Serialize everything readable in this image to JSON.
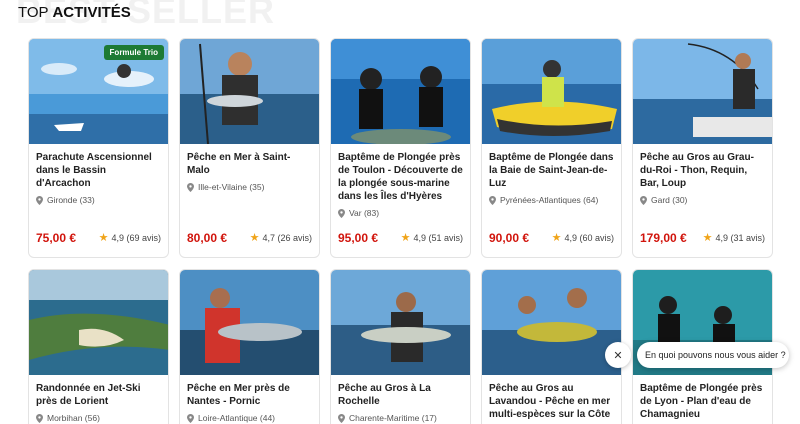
{
  "background_word": "BEST SELLER",
  "section": {
    "title_prefix": "TOP ",
    "title_bold": "ACTIVITÉS"
  },
  "cards": [
    {
      "title": "Parachute Ascensionnel dans le Bassin d'Arcachon",
      "location": "Gironde (33)",
      "price": "75,00 €",
      "rating": "4,9 (69 avis)",
      "badge": "Formule Trio"
    },
    {
      "title": "Pêche en Mer à Saint-Malo",
      "location": "Ille-et-Vilaine (35)",
      "price": "80,00 €",
      "rating": "4,7 (26 avis)"
    },
    {
      "title": "Baptême de Plongée près de Toulon - Découverte de la plongée sous-marine dans les Îles d'Hyères",
      "location": "Var (83)",
      "price": "95,00 €",
      "rating": "4,9 (51 avis)"
    },
    {
      "title": "Baptême de Plongée dans la Baie de Saint-Jean-de-Luz",
      "location": "Pyrénées-Atlantiques (64)",
      "price": "90,00 €",
      "rating": "4,9 (60 avis)"
    },
    {
      "title": "Pêche au Gros au Grau-du-Roi - Thon, Requin, Bar, Loup",
      "location": "Gard (30)",
      "price": "179,00 €",
      "rating": "4,9 (31 avis)"
    },
    {
      "title": "Randonnée en Jet-Ski près de Lorient",
      "location": "Morbihan (56)"
    },
    {
      "title": "Pêche en Mer près de Nantes - Pornic",
      "location": "Loire-Atlantique (44)"
    },
    {
      "title": "Pêche au Gros à La Rochelle",
      "location": "Charente-Maritime (17)"
    },
    {
      "title": "Pêche au Gros au Lavandou - Pêche en mer multi-espèces sur la Côte",
      "location": ""
    },
    {
      "title": "Baptême de Plongée près de Lyon - Plan d'eau de Chamagnieu",
      "location": ""
    }
  ],
  "chat": {
    "close": "✕",
    "prompt": "En quoi pouvons nous vous aider ?"
  },
  "colors": {
    "price": "#d1140c",
    "star": "#f0a419",
    "badge": "#1d7a34"
  }
}
